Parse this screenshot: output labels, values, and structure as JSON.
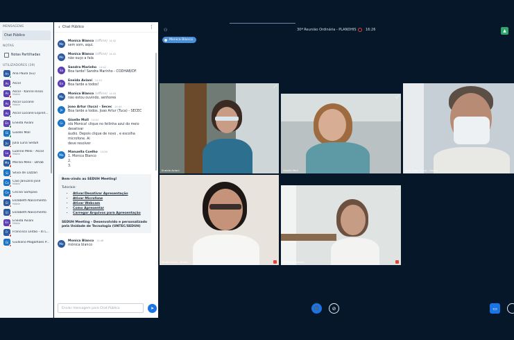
{
  "sidebar": {
    "messages_heading": "MENSAGENS",
    "public_chat_label": "Chat Público",
    "notes_heading": "NOTAS",
    "shared_notes_label": "Notas Partilhadas",
    "users_heading": "UTILIZADORES (39)",
    "users": [
      {
        "initials": "An",
        "name": "Ana Paula (Eu)",
        "sub": "",
        "color": "#2c5aa0",
        "status": "on"
      },
      {
        "initials": "As",
        "name": "Ascol",
        "sub": "",
        "color": "#5b3fb1",
        "status": "on"
      },
      {
        "initials": "As",
        "name": "Ascol - Karine Risso",
        "sub": "Móbile",
        "color": "#5b3fb1",
        "status": "off"
      },
      {
        "initials": "As",
        "name": "Ascol Luciane",
        "sub": "Móbile",
        "color": "#5b3fb1",
        "status": "off"
      },
      {
        "initials": "As",
        "name": "Ascol Luciane Espind...",
        "sub": "",
        "color": "#5b3fb1",
        "status": "on"
      },
      {
        "initials": "En",
        "name": "Eneida Aviani",
        "sub": "",
        "color": "#5b3fb1",
        "status": "on"
      },
      {
        "initials": "Gi",
        "name": "Giselle Moll",
        "sub": "",
        "color": "#1b74c4",
        "status": "on"
      },
      {
        "initials": "Ju",
        "name": "Julia Luna Seduh",
        "sub": "",
        "color": "#2c5aa0",
        "status": "off"
      },
      {
        "initials": "Lu",
        "name": "Luanne Melo - Ascol",
        "sub": "Móbile",
        "color": "#5b3fb1",
        "status": "off"
      },
      {
        "initials": "Ma",
        "name": "Marilia Melo - Dihab",
        "sub": "",
        "color": "#2c5aa0",
        "status": "off"
      },
      {
        "initials": "Si",
        "name": "Silvia de Lazzari",
        "sub": "",
        "color": "#1b74c4",
        "status": "off"
      },
      {
        "initials": "Ca",
        "name": "Caio Januário José",
        "sub": "Móbile",
        "color": "#1b74c4",
        "status": "off"
      },
      {
        "initials": "Ce",
        "name": "Cecilia Sampaio",
        "sub": "",
        "color": "#1b74c4",
        "status": "off"
      },
      {
        "initials": "El",
        "name": "Elizabeth Nascimento",
        "sub": "Móbile",
        "color": "#2c5aa0",
        "status": "off"
      },
      {
        "initials": "El",
        "name": "Elizabeth Nascimento",
        "sub": "",
        "color": "#2c5aa0",
        "status": "off"
      },
      {
        "initials": "En",
        "name": "Eneida Aviani",
        "sub": "Móbile",
        "color": "#5b3fb1",
        "status": "off"
      },
      {
        "initials": "Fr",
        "name": "Francisco Leitao - di L...",
        "sub": "",
        "color": "#2c5aa0",
        "status": "off"
      },
      {
        "initials": "Gi",
        "name": "Giulliano Magalhaes P...",
        "sub": "",
        "color": "#1b74c4",
        "status": "off"
      }
    ]
  },
  "chat": {
    "title": "Chat Público",
    "input_placeholder": "Enviar mensagem para Chat Público",
    "messages": [
      {
        "initials": "Mo",
        "color": "#2c5aa0",
        "name": "Monica Blanco",
        "offline": "(offline)",
        "time": "14:42",
        "lines": [
          "sem som, aqui."
        ]
      },
      {
        "initials": "Mo",
        "color": "#2c5aa0",
        "name": "Monica Blanco",
        "offline": "(offline)",
        "time": "14:42",
        "lines": [
          "não ouço a fala"
        ]
      },
      {
        "initials": "Sa",
        "color": "#5b3fb1",
        "name": "Sandra Marinho",
        "offline": "",
        "time": "14:42",
        "lines": [
          "Boa tarde! Sandra Marinho - CODHAB/DF."
        ]
      },
      {
        "initials": "En",
        "color": "#5b3fb1",
        "name": "Eneida Aviani",
        "offline": "",
        "time": "14:43",
        "lines": [
          "Boa tarde a todos!"
        ]
      },
      {
        "initials": "Mo",
        "color": "#2c5aa0",
        "name": "Monica Blanco",
        "offline": "(offline)",
        "time": "14:43",
        "lines": [
          "não estou ouvindo, senhores"
        ]
      },
      {
        "initials": "Jo",
        "color": "#1b74c4",
        "name": "Joao Artur (tuca) - Secec",
        "offline": "",
        "time": "14:44",
        "lines": [
          "Boa tarde a todos. Joao Artur (Tuca) - SECEC"
        ]
      },
      {
        "initials": "Gi",
        "color": "#1b74c4",
        "name": "Giselle Moll",
        "offline": "",
        "time": "14:44",
        "lines": [
          "olá Monica! clique no feilinha azul do meio desativar",
          "áudio. Depois clique de novo , e escolha microfone. Ai",
          "deve resolver"
        ]
      },
      {
        "initials": "Ma",
        "color": "#1b74c4",
        "name": "Manuella Coelho",
        "offline": "",
        "time": "14:46",
        "lines": [
          "1. Monica Blanco",
          "2.",
          "3."
        ]
      }
    ],
    "welcome": {
      "title": "Bem-vindo ao SEDUH Meeting!",
      "subtitle": "Tutoriais:",
      "links": [
        "Ativar/Desativar Apresentação",
        "Ativar Microfone",
        "Ativar Webcam",
        "Como Apresentar",
        "Carregar Arquivos para Apresentação"
      ],
      "footer": "SEDUH Meeting - Desenvolvido e personalizado pela Unidade de Tecnologia (UNTEC/SEDUH)"
    },
    "last_message": {
      "initials": "Mo",
      "color": "#2c5aa0",
      "name": "Monica Blanco",
      "offline": "",
      "time": "14:46",
      "lines": [
        "mônica blanco"
      ]
    }
  },
  "meeting": {
    "title": "30ª Reunião Ordinária - PLANDHIS",
    "time": "16:26",
    "presenter": "Monica Blanco",
    "tiles": [
      {
        "name": "Eneida Aviani",
        "muted": false
      },
      {
        "name": "Giselle Moll",
        "muted": false
      },
      {
        "name": "Joao Artur (Tuca) - Secec",
        "muted": false
      },
      {
        "name": "Marilia Melo - Dihab",
        "muted": true
      },
      {
        "name": "Silvia de Lazzari",
        "muted": true
      }
    ]
  },
  "icons": {
    "expand": "⤢",
    "send": "➤",
    "back": "‹",
    "more": "⋮",
    "audio": "🎧",
    "video": "⊘",
    "screen": "▭",
    "user_settings": "⚇"
  }
}
